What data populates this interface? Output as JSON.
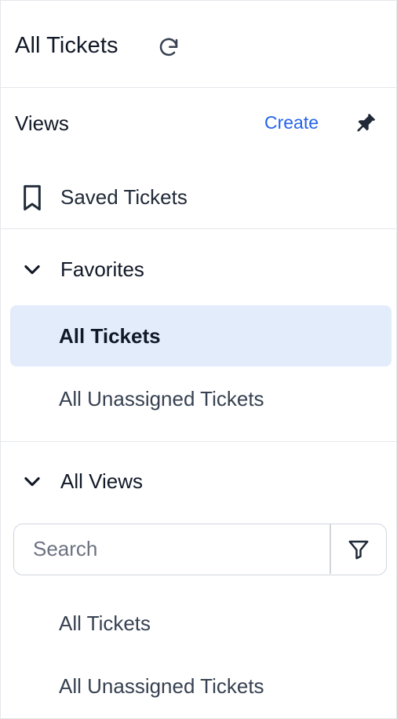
{
  "header": {
    "title": "All Tickets",
    "refresh_icon": "refresh-icon"
  },
  "views": {
    "label": "Views",
    "create_label": "Create",
    "pin_icon": "pin-icon"
  },
  "saved": {
    "label": "Saved Tickets",
    "icon": "bookmark-icon"
  },
  "favorites": {
    "label": "Favorites",
    "items": [
      {
        "label": "All Tickets",
        "active": true
      },
      {
        "label": "All Unassigned Tickets",
        "active": false
      }
    ]
  },
  "all_views": {
    "label": "All Views",
    "search_placeholder": "Search",
    "filter_icon": "filter-icon",
    "items": [
      {
        "label": "All Tickets"
      },
      {
        "label": "All Unassigned Tickets"
      }
    ]
  },
  "colors": {
    "accent": "#2563eb",
    "active_bg": "#e3ecfb",
    "border": "#e5e7eb"
  }
}
